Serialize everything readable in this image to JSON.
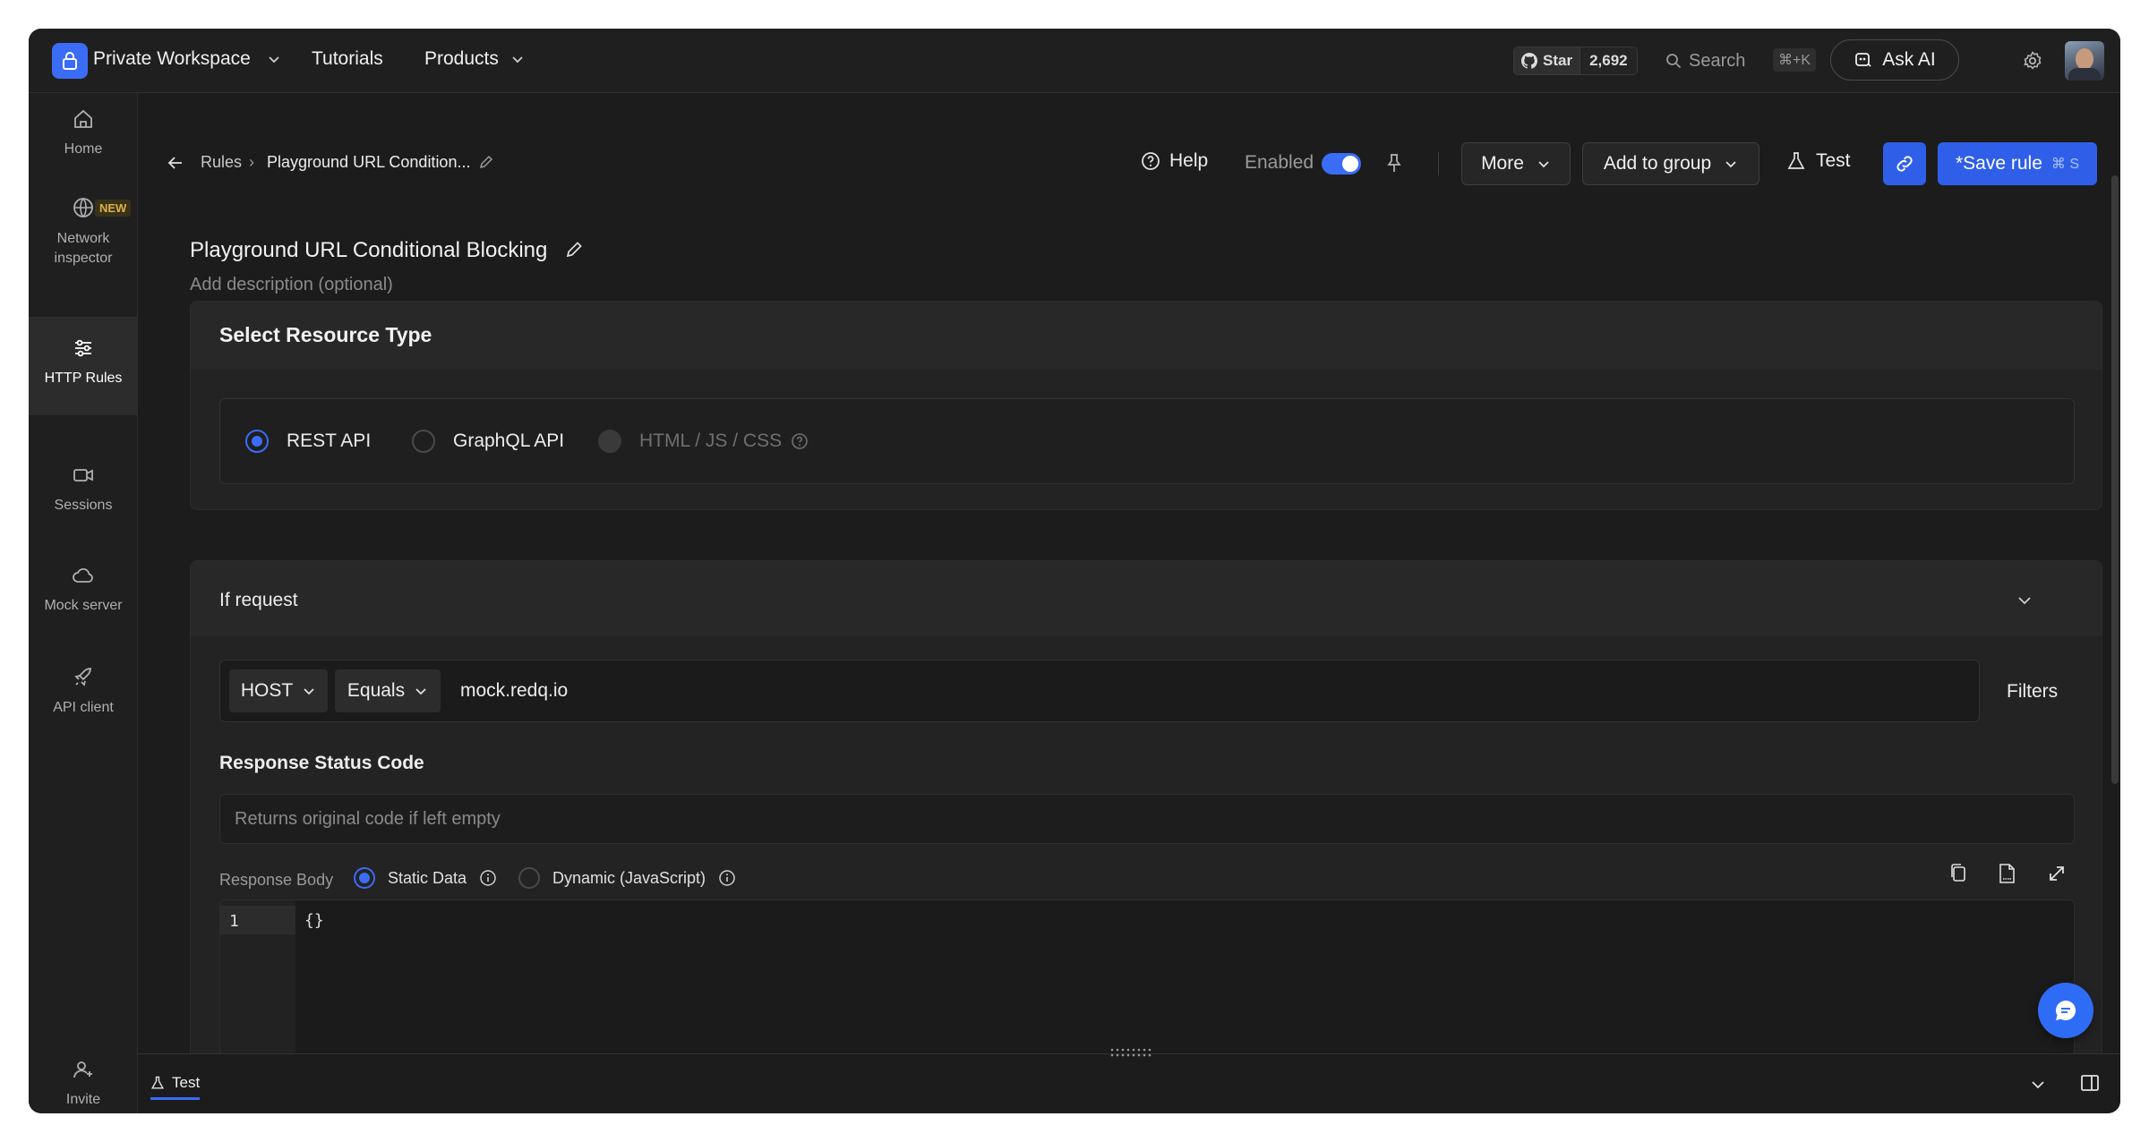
{
  "topbar": {
    "workspace_name": "Private Workspace",
    "nav": [
      "Tutorials",
      "Products"
    ],
    "github_star_label": "Star",
    "github_star_count": "2,692",
    "search_label": "Search",
    "search_shortcut": "⌘+K",
    "ask_ai_label": "Ask AI"
  },
  "sidebar": {
    "items": [
      {
        "label": "Home",
        "icon": "home-icon"
      },
      {
        "label": "Network inspector",
        "icon": "globe-icon",
        "badge": "NEW"
      },
      {
        "label": "HTTP Rules",
        "icon": "sliders-icon",
        "active": true
      },
      {
        "label": "Sessions",
        "icon": "video-icon"
      },
      {
        "label": "Mock server",
        "icon": "cloud-icon"
      },
      {
        "label": "API client",
        "icon": "rocket-icon"
      },
      {
        "label": "Invite",
        "icon": "user-plus-icon"
      }
    ]
  },
  "header": {
    "breadcrumb_root": "Rules",
    "breadcrumb_sep": "›",
    "breadcrumb_current": "Playground URL Condition...",
    "help_label": "Help",
    "enabled_label": "Enabled",
    "enabled": true,
    "more_label": "More",
    "add_to_group_label": "Add to group",
    "test_label": "Test",
    "save_label": "*Save rule",
    "save_shortcut": "⌘ S"
  },
  "rule": {
    "title": "Playground URL Conditional Blocking",
    "description_placeholder": "Add description (optional)"
  },
  "resource_type": {
    "heading": "Select Resource Type",
    "options": [
      {
        "label": "REST API",
        "selected": true,
        "disabled": false
      },
      {
        "label": "GraphQL API",
        "selected": false,
        "disabled": false
      },
      {
        "label": "HTML / JS / CSS",
        "selected": false,
        "disabled": true
      }
    ]
  },
  "if_request": {
    "heading": "If request",
    "key": "HOST",
    "operator": "Equals",
    "value": "mock.redq.io",
    "filters_label": "Filters",
    "status_code_label": "Response Status Code",
    "status_code_placeholder": "Returns original code if left empty",
    "response_body_label": "Response Body",
    "body_options": [
      {
        "label": "Static Data",
        "selected": true
      },
      {
        "label": "Dynamic (JavaScript)",
        "selected": false
      }
    ],
    "editor_line_number": "1",
    "editor_content": "{}"
  },
  "bottom_panel": {
    "tab_label": "Test"
  },
  "colors": {
    "accent": "#3b6cf6",
    "background": "#1c1c1c",
    "new_badge": "#d9b24a"
  }
}
